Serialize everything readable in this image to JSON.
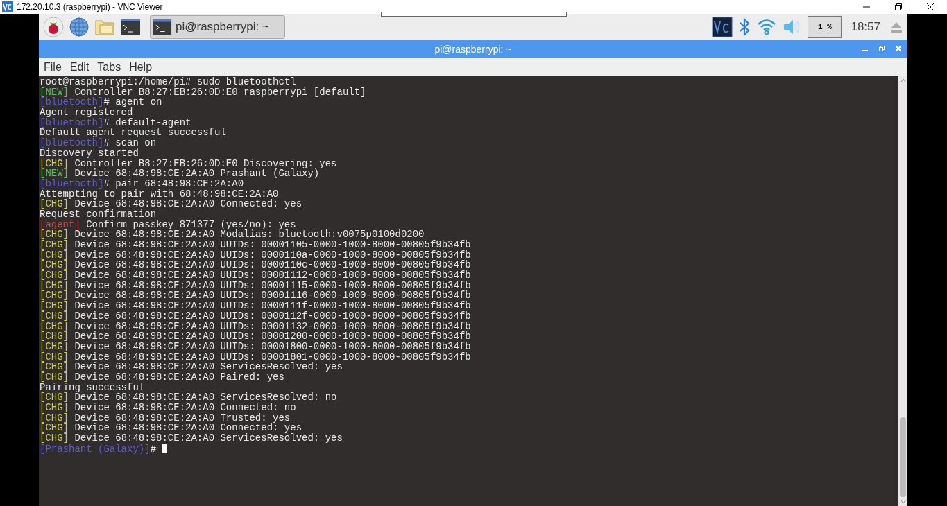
{
  "viewer": {
    "title": "172.20.10.3 (raspberrypi) - VNC Viewer"
  },
  "taskbar": {
    "window_button": "pi@raspberrypi: ~",
    "cpu": "1 %",
    "clock": "18:57"
  },
  "window": {
    "title": "pi@raspberrypi: ~"
  },
  "menu": [
    "File",
    "Edit",
    "Tabs",
    "Help"
  ],
  "terminal": {
    "lines": [
      {
        "text": "root@raspberrypi:/home/pi# sudo bluetoothctl"
      },
      {
        "prefix": {
          "text": "[NEW]",
          "color": "#4ec94e"
        },
        "text": " Controller B8:27:EB:26:0D:E0 raspberrypi [default]"
      },
      {
        "prefix": {
          "text": "[bluetooth]",
          "color": "#5a5ad6"
        },
        "text": "# agent on"
      },
      {
        "text": "Agent registered"
      },
      {
        "prefix": {
          "text": "[bluetooth]",
          "color": "#5a5ad6"
        },
        "text": "# default-agent"
      },
      {
        "text": "Default agent request successful"
      },
      {
        "prefix": {
          "text": "[bluetooth]",
          "color": "#5a5ad6"
        },
        "text": "# scan on"
      },
      {
        "text": "Discovery started"
      },
      {
        "prefix": {
          "text": "[CHG]",
          "color": "#cfcf4a"
        },
        "text": " Controller B8:27:EB:26:0D:E0 Discovering: yes"
      },
      {
        "prefix": {
          "text": "[NEW]",
          "color": "#4ec94e"
        },
        "text": " Device 68:48:98:CE:2A:A0 Prashant (Galaxy)"
      },
      {
        "prefix": {
          "text": "[bluetooth]",
          "color": "#5a5ad6"
        },
        "text": "# pair 68:48:98:CE:2A:A0"
      },
      {
        "text": "Attempting to pair with 68:48:98:CE:2A:A0"
      },
      {
        "prefix": {
          "text": "[CHG]",
          "color": "#cfcf4a"
        },
        "text": " Device 68:48:98:CE:2A:A0 Connected: yes"
      },
      {
        "text": "Request confirmation"
      },
      {
        "prefix": {
          "text": "[agent]",
          "color": "#c94a4a"
        },
        "text": " Confirm passkey 871377 (yes/no): yes"
      },
      {
        "prefix": {
          "text": "[CHG]",
          "color": "#cfcf4a"
        },
        "text": " Device 68:48:98:CE:2A:A0 Modalias: bluetooth:v0075p0100d0200"
      },
      {
        "prefix": {
          "text": "[CHG]",
          "color": "#cfcf4a"
        },
        "text": " Device 68:48:98:CE:2A:A0 UUIDs: 00001105-0000-1000-8000-00805f9b34fb"
      },
      {
        "prefix": {
          "text": "[CHG]",
          "color": "#cfcf4a"
        },
        "text": " Device 68:48:98:CE:2A:A0 UUIDs: 0000110a-0000-1000-8000-00805f9b34fb"
      },
      {
        "prefix": {
          "text": "[CHG]",
          "color": "#cfcf4a"
        },
        "text": " Device 68:48:98:CE:2A:A0 UUIDs: 0000110c-0000-1000-8000-00805f9b34fb"
      },
      {
        "prefix": {
          "text": "[CHG]",
          "color": "#cfcf4a"
        },
        "text": " Device 68:48:98:CE:2A:A0 UUIDs: 00001112-0000-1000-8000-00805f9b34fb"
      },
      {
        "prefix": {
          "text": "[CHG]",
          "color": "#cfcf4a"
        },
        "text": " Device 68:48:98:CE:2A:A0 UUIDs: 00001115-0000-1000-8000-00805f9b34fb"
      },
      {
        "prefix": {
          "text": "[CHG]",
          "color": "#cfcf4a"
        },
        "text": " Device 68:48:98:CE:2A:A0 UUIDs: 00001116-0000-1000-8000-00805f9b34fb"
      },
      {
        "prefix": {
          "text": "[CHG]",
          "color": "#cfcf4a"
        },
        "text": " Device 68:48:98:CE:2A:A0 UUIDs: 0000111f-0000-1000-8000-00805f9b34fb"
      },
      {
        "prefix": {
          "text": "[CHG]",
          "color": "#cfcf4a"
        },
        "text": " Device 68:48:98:CE:2A:A0 UUIDs: 0000112f-0000-1000-8000-00805f9b34fb"
      },
      {
        "prefix": {
          "text": "[CHG]",
          "color": "#cfcf4a"
        },
        "text": " Device 68:48:98:CE:2A:A0 UUIDs: 00001132-0000-1000-8000-00805f9b34fb"
      },
      {
        "prefix": {
          "text": "[CHG]",
          "color": "#cfcf4a"
        },
        "text": " Device 68:48:98:CE:2A:A0 UUIDs: 00001200-0000-1000-8000-00805f9b34fb"
      },
      {
        "prefix": {
          "text": "[CHG]",
          "color": "#cfcf4a"
        },
        "text": " Device 68:48:98:CE:2A:A0 UUIDs: 00001800-0000-1000-8000-00805f9b34fb"
      },
      {
        "prefix": {
          "text": "[CHG]",
          "color": "#cfcf4a"
        },
        "text": " Device 68:48:98:CE:2A:A0 UUIDs: 00001801-0000-1000-8000-00805f9b34fb"
      },
      {
        "prefix": {
          "text": "[CHG]",
          "color": "#cfcf4a"
        },
        "text": " Device 68:48:98:CE:2A:A0 ServicesResolved: yes"
      },
      {
        "prefix": {
          "text": "[CHG]",
          "color": "#cfcf4a"
        },
        "text": " Device 68:48:98:CE:2A:A0 Paired: yes"
      },
      {
        "text": "Pairing successful"
      },
      {
        "prefix": {
          "text": "[CHG]",
          "color": "#cfcf4a"
        },
        "text": " Device 68:48:98:CE:2A:A0 ServicesResolved: no"
      },
      {
        "prefix": {
          "text": "[CHG]",
          "color": "#cfcf4a"
        },
        "text": " Device 68:48:98:CE:2A:A0 Connected: no"
      },
      {
        "prefix": {
          "text": "[CHG]",
          "color": "#cfcf4a"
        },
        "text": " Device 68:48:98:CE:2A:A0 Trusted: yes"
      },
      {
        "prefix": {
          "text": "[CHG]",
          "color": "#cfcf4a"
        },
        "text": " Device 68:48:98:CE:2A:A0 Connected: yes"
      },
      {
        "prefix": {
          "text": "[CHG]",
          "color": "#cfcf4a"
        },
        "text": " Device 68:48:98:CE:2A:A0 ServicesResolved: yes"
      },
      {
        "prefix": {
          "text": "[Prashant (Galaxy)]",
          "color": "#5a5ad6"
        },
        "text": "# ",
        "cursor": true
      }
    ]
  }
}
